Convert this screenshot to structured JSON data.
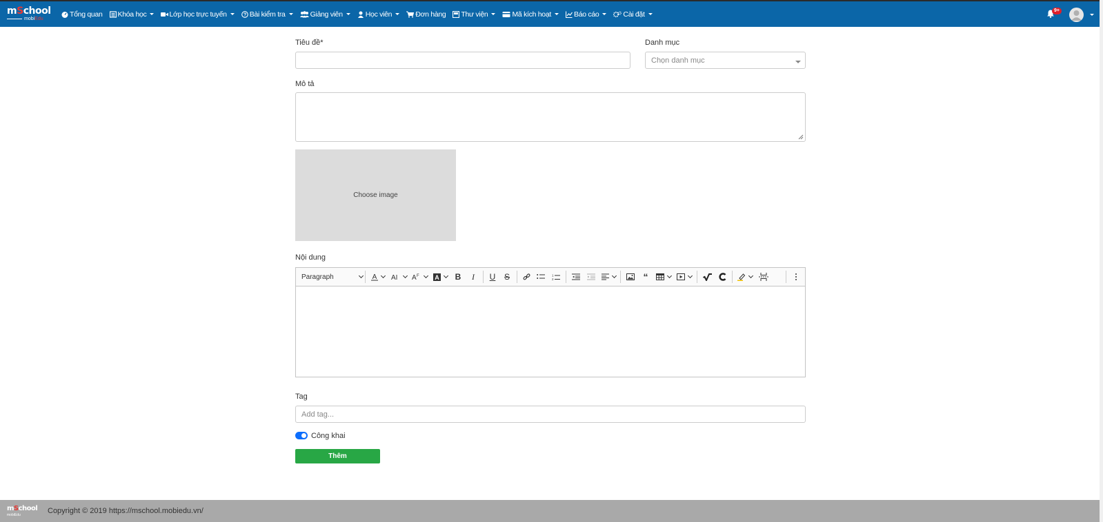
{
  "navbar": {
    "logo_main": "m",
    "logo_o": "S",
    "logo_rest": "chool",
    "logo_sub": "mobi",
    "logo_sub_accent": "Edu",
    "items": [
      {
        "label": "Tổng quan",
        "icon": "dashboard-icon",
        "dropdown": false
      },
      {
        "label": "Khóa học",
        "icon": "course-icon",
        "dropdown": true
      },
      {
        "label": "Lớp học trực tuyến",
        "icon": "video-icon",
        "dropdown": true
      },
      {
        "label": "Bài kiểm tra",
        "icon": "question-icon",
        "dropdown": true
      },
      {
        "label": "Giảng viên",
        "icon": "users-icon",
        "dropdown": true
      },
      {
        "label": "Học viên",
        "icon": "user-icon",
        "dropdown": true
      },
      {
        "label": "Đơn hàng",
        "icon": "cart-icon",
        "dropdown": false
      },
      {
        "label": "Thư viện",
        "icon": "library-icon",
        "dropdown": true
      },
      {
        "label": "Mã kích hoạt",
        "icon": "card-icon",
        "dropdown": true
      },
      {
        "label": "Báo cáo",
        "icon": "chart-icon",
        "dropdown": true
      },
      {
        "label": "Cài đặt",
        "icon": "gears-icon",
        "dropdown": true
      }
    ],
    "notification_badge": "9+",
    "color": "#0b66a8"
  },
  "form": {
    "title_label": "Tiêu đề*",
    "title_value": "",
    "category_label": "Danh mục",
    "category_placeholder": "Chọn danh mục",
    "description_label": "Mô tả",
    "description_value": "",
    "image_label": "Choose image",
    "content_label": "Nội dung",
    "editor": {
      "paragraph": "Paragraph",
      "tools": [
        "font-color-icon",
        "font-size-icon",
        "font-family-icon",
        "highlight-bg-icon",
        "bold-icon",
        "italic-icon",
        "underline-icon",
        "strikethrough-icon",
        "link-icon",
        "bulleted-list-icon",
        "numbered-list-icon",
        "outdent-icon",
        "indent-icon",
        "align-icon",
        "image-icon",
        "blockquote-icon",
        "table-icon",
        "media-icon",
        "math-icon",
        "chemistry-icon",
        "highlight-icon",
        "page-break-icon",
        "more-icon"
      ]
    },
    "tag_label": "Tag",
    "tag_placeholder": "Add tag...",
    "public_label": "Công khai",
    "public_checked": true,
    "submit_label": "Thêm",
    "submit_color": "#28a745"
  },
  "footer": {
    "logo_main": "m",
    "logo_o": "S",
    "logo_rest": "chool",
    "logo_sub": "mobiEdu",
    "copyright": "Copyright © 2019 https://mschool.mobiedu.vn/"
  }
}
